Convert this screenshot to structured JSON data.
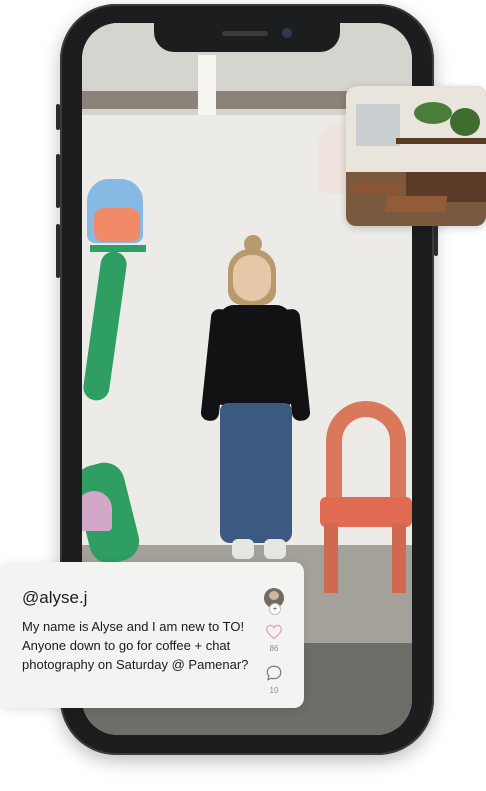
{
  "post": {
    "handle": "@alyse.j",
    "text_lines": [
      "My name is Alyse and I am new to TO!",
      "Anyone down to go for coffee + chat",
      "photography on Saturday @ Pamenar?"
    ],
    "avatar_badge": "+",
    "likes": "86",
    "comments": "10"
  },
  "icons": {
    "like": "heart-icon",
    "comment": "comment-bubble-icon",
    "avatar": "user-avatar"
  },
  "colors": {
    "card_bg": "#f3f3f1",
    "heart": "#e9a5b6",
    "phone_body": "#1c1d1f"
  }
}
